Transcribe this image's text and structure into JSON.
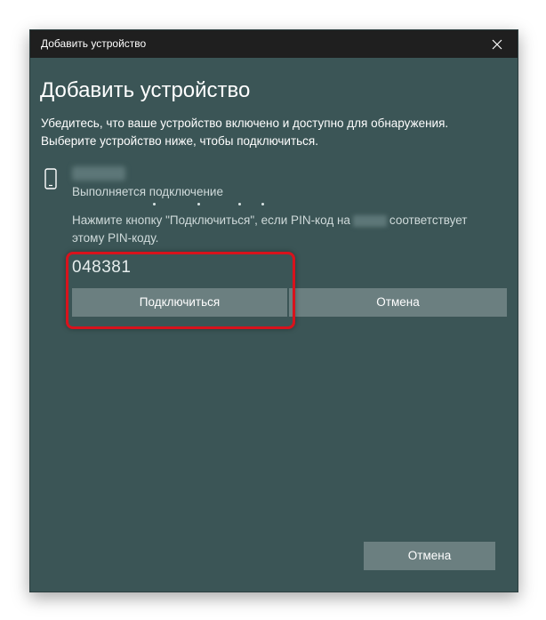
{
  "window": {
    "title": "Добавить устройство",
    "heading": "Добавить устройство"
  },
  "intro": {
    "line1": "Убедитесь, что ваше устройство включено и доступно для обнаружения.",
    "line2": "Выберите устройство ниже, чтобы подключиться."
  },
  "device": {
    "icon": "phone-icon",
    "name": "",
    "status": "Выполняется подключение",
    "hint_before": "Нажмите кнопку \"Подключиться\", если PIN-код на",
    "hint_after": "соответствует этому PIN-коду.",
    "pin": "048381"
  },
  "buttons": {
    "connect": "Подключиться",
    "cancel_inline": "Отмена",
    "cancel_bottom": "Отмена"
  },
  "colors": {
    "window_bg": "#3b5556",
    "titlebar_bg": "#1f1f1f",
    "button_bg": "#6b7f80",
    "highlight": "#d8121c"
  }
}
